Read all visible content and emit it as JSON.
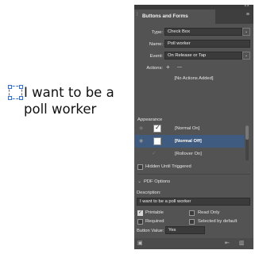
{
  "document": {
    "text": "I want to be a poll worker"
  },
  "panel": {
    "title": "Buttons and Forms",
    "type_label": "Type:",
    "type_value": "Check Box",
    "name_label": "Name:",
    "name_value": "Poll worker",
    "event_label": "Event:",
    "event_value": "On Release or Tap",
    "actions_label": "Actions:",
    "add_action": "+",
    "remove_action": "—",
    "no_actions": "[No Actions Added]",
    "appearance_label": "Appearance",
    "appearance_states": [
      {
        "label": "[Normal On]",
        "checked": true
      },
      {
        "label": "[Normal Off]",
        "checked": false
      },
      {
        "label": "[Rollover On]",
        "checked": false
      }
    ],
    "hidden_until_triggered": "Hidden Until Triggered",
    "pdf_options": "PDF Options",
    "description_label": "Description:",
    "description_value": "I want to be a poll worker",
    "printable": "Printable",
    "read_only": "Read Only",
    "required": "Required",
    "selected_by_default": "Selected by default",
    "button_value_label": "Button Value:",
    "button_value": "Yes",
    "close_glyph": "××",
    "menu_glyph": "≡"
  },
  "colors": {
    "panel_bg": "#535353",
    "selection": "#3f5b80",
    "frame": "#3d6bd6"
  }
}
